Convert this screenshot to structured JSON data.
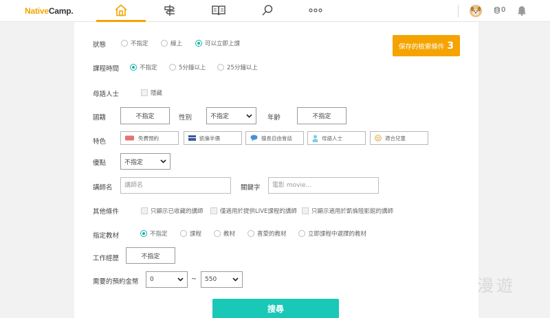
{
  "header": {
    "logo_part1": "Native",
    "logo_part2": "Camp.",
    "nav": [
      {
        "icon": "home-icon",
        "active": true
      },
      {
        "icon": "signpost-icon"
      },
      {
        "icon": "book-icon"
      },
      {
        "icon": "search-icon"
      },
      {
        "icon": "more-icon"
      }
    ],
    "coins": "0"
  },
  "filters": {
    "status": {
      "label": "狀態",
      "options": [
        "不指定",
        "線上",
        "可以立即上課"
      ],
      "selected": 2
    },
    "duration": {
      "label": "課程時間",
      "options": [
        "不指定",
        "5分鐘以上",
        "25分鐘以上"
      ],
      "selected": 0
    },
    "native": {
      "label": "母語人士",
      "option": "隱藏"
    },
    "nationality": {
      "label": "國籍",
      "value": "不指定"
    },
    "gender": {
      "label": "性別",
      "value": "不指定"
    },
    "age": {
      "label": "年齡",
      "value": "不指定"
    },
    "features": {
      "label": "特色",
      "chips": [
        {
          "icon": "ticket-icon",
          "text": "免費預約"
        },
        {
          "icon": "flag-icon",
          "text": "凱倫半價"
        },
        {
          "icon": "chat-icon",
          "text": "擅長自由會話"
        },
        {
          "icon": "person-icon",
          "text": "母語人士"
        },
        {
          "icon": "smile-icon",
          "text": "適合兒童"
        }
      ]
    },
    "strength": {
      "label": "優點",
      "value": "不指定"
    },
    "teacher_name": {
      "label": "講師名",
      "placeholder": "講師名"
    },
    "keyword": {
      "label": "關鍵字",
      "placeholder": "電影 movie..."
    },
    "other": {
      "label": "其他條件",
      "options": [
        "只顯示已收藏的講師",
        "僅適用於提供LIVE課程的講師",
        "只顯示適用於凱倫陸影館的講師"
      ]
    },
    "material": {
      "label": "指定教材",
      "options": [
        "不指定",
        "課程",
        "教材",
        "喜愛的教材",
        "立即課程中選擇的教材"
      ],
      "selected": 0
    },
    "experience": {
      "label": "工作經歷",
      "value": "不指定"
    },
    "price": {
      "label": "需要的預約金幣",
      "min": "0",
      "separator": "~",
      "max": "550"
    }
  },
  "saved_search": {
    "label": "保存的檢索條件",
    "count": "3"
  },
  "search_button": "搜尋",
  "watermark": "漫遊",
  "colors": {
    "brand_orange": "#f5a300",
    "teal": "#1ac8b8",
    "radio_on": "#13b5ad"
  }
}
